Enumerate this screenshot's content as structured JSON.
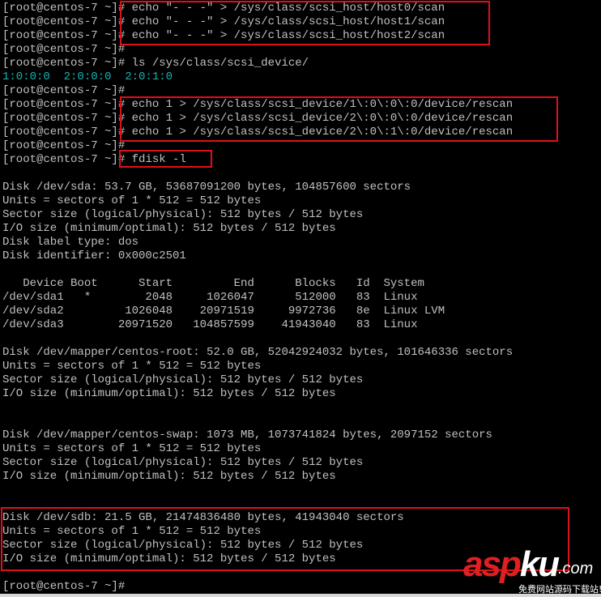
{
  "terminal": {
    "prompt": "[root@centos-7 ~]#",
    "lines": [
      {
        "prompt": "[root@centos-7 ~]#",
        "text": " echo \"- - -\" > /sys/class/scsi_host/host0/scan"
      },
      {
        "prompt": "[root@centos-7 ~]#",
        "text": " echo \"- - -\" > /sys/class/scsi_host/host1/scan"
      },
      {
        "prompt": "[root@centos-7 ~]#",
        "text": " echo \"- - -\" > /sys/class/scsi_host/host2/scan"
      },
      {
        "prompt": "[root@centos-7 ~]#",
        "text": ""
      },
      {
        "prompt": "[root@centos-7 ~]#",
        "text": " ls /sys/class/scsi_device/"
      },
      {
        "prompt": "",
        "text": "1:0:0:0  2:0:0:0  2:0:1:0"
      },
      {
        "prompt": "[root@centos-7 ~]#",
        "text": ""
      },
      {
        "prompt": "[root@centos-7 ~]#",
        "text": " echo 1 > /sys/class/scsi_device/1\\:0\\:0\\:0/device/rescan"
      },
      {
        "prompt": "[root@centos-7 ~]#",
        "text": " echo 1 > /sys/class/scsi_device/2\\:0\\:0\\:0/device/rescan"
      },
      {
        "prompt": "[root@centos-7 ~]#",
        "text": " echo 1 > /sys/class/scsi_device/2\\:0\\:1\\:0/device/rescan"
      },
      {
        "prompt": "[root@centos-7 ~]#",
        "text": ""
      },
      {
        "prompt": "[root@centos-7 ~]#",
        "text": " fdisk -l"
      },
      {
        "prompt": "",
        "text": ""
      },
      {
        "prompt": "",
        "text": "Disk /dev/sda: 53.7 GB, 53687091200 bytes, 104857600 sectors"
      },
      {
        "prompt": "",
        "text": "Units = sectors of 1 * 512 = 512 bytes"
      },
      {
        "prompt": "",
        "text": "Sector size (logical/physical): 512 bytes / 512 bytes"
      },
      {
        "prompt": "",
        "text": "I/O size (minimum/optimal): 512 bytes / 512 bytes"
      },
      {
        "prompt": "",
        "text": "Disk label type: dos"
      },
      {
        "prompt": "",
        "text": "Disk identifier: 0x000c2501"
      },
      {
        "prompt": "",
        "text": ""
      },
      {
        "prompt": "",
        "text": "   Device Boot      Start         End      Blocks   Id  System"
      },
      {
        "prompt": "",
        "text": "/dev/sda1   *        2048     1026047      512000   83  Linux"
      },
      {
        "prompt": "",
        "text": "/dev/sda2         1026048    20971519     9972736   8e  Linux LVM"
      },
      {
        "prompt": "",
        "text": "/dev/sda3        20971520   104857599    41943040   83  Linux"
      },
      {
        "prompt": "",
        "text": ""
      },
      {
        "prompt": "",
        "text": "Disk /dev/mapper/centos-root: 52.0 GB, 52042924032 bytes, 101646336 sectors"
      },
      {
        "prompt": "",
        "text": "Units = sectors of 1 * 512 = 512 bytes"
      },
      {
        "prompt": "",
        "text": "Sector size (logical/physical): 512 bytes / 512 bytes"
      },
      {
        "prompt": "",
        "text": "I/O size (minimum/optimal): 512 bytes / 512 bytes"
      },
      {
        "prompt": "",
        "text": ""
      },
      {
        "prompt": "",
        "text": ""
      },
      {
        "prompt": "",
        "text": "Disk /dev/mapper/centos-swap: 1073 MB, 1073741824 bytes, 2097152 sectors"
      },
      {
        "prompt": "",
        "text": "Units = sectors of 1 * 512 = 512 bytes"
      },
      {
        "prompt": "",
        "text": "Sector size (logical/physical): 512 bytes / 512 bytes"
      },
      {
        "prompt": "",
        "text": "I/O size (minimum/optimal): 512 bytes / 512 bytes"
      },
      {
        "prompt": "",
        "text": ""
      },
      {
        "prompt": "",
        "text": ""
      },
      {
        "prompt": "",
        "text": "Disk /dev/sdb: 21.5 GB, 21474836480 bytes, 41943040 sectors"
      },
      {
        "prompt": "",
        "text": "Units = sectors of 1 * 512 = 512 bytes"
      },
      {
        "prompt": "",
        "text": "Sector size (logical/physical): 512 bytes / 512 bytes"
      },
      {
        "prompt": "",
        "text": "I/O size (minimum/optimal): 512 bytes / 512 bytes"
      },
      {
        "prompt": "",
        "text": ""
      },
      {
        "prompt": "[root@centos-7 ~]#",
        "text": ""
      }
    ],
    "highlight_color": "#e0101a",
    "output_color": "#18b2b2"
  },
  "watermark": {
    "brand_red": "asp",
    "brand_white": "ku",
    "suffix": ".com",
    "slogan": "免费网站源码下载站!"
  }
}
